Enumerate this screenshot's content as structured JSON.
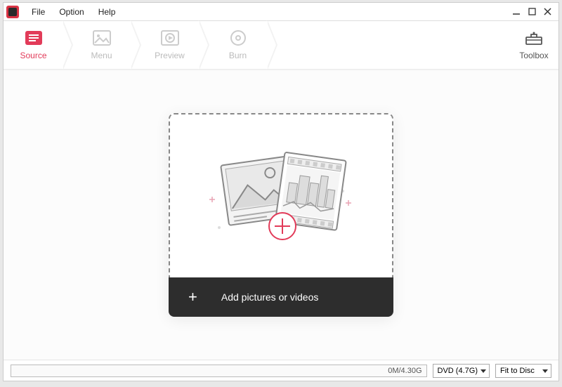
{
  "menubar": {
    "items": [
      "File",
      "Option",
      "Help"
    ]
  },
  "steps": [
    {
      "label": "Source",
      "icon": "text-lines-icon",
      "active": true
    },
    {
      "label": "Menu",
      "icon": "photo-icon"
    },
    {
      "label": "Preview",
      "icon": "play-circle-icon"
    },
    {
      "label": "Burn",
      "icon": "disc-icon"
    }
  ],
  "toolbox": {
    "label": "Toolbox"
  },
  "dropzone": {
    "add_label": "Add pictures or videos"
  },
  "status": {
    "progress_text": "0M/4.30G",
    "disc_type": "DVD (4.7G)",
    "fit_mode": "Fit to Disc"
  },
  "colors": {
    "accent": "#e23b59"
  }
}
